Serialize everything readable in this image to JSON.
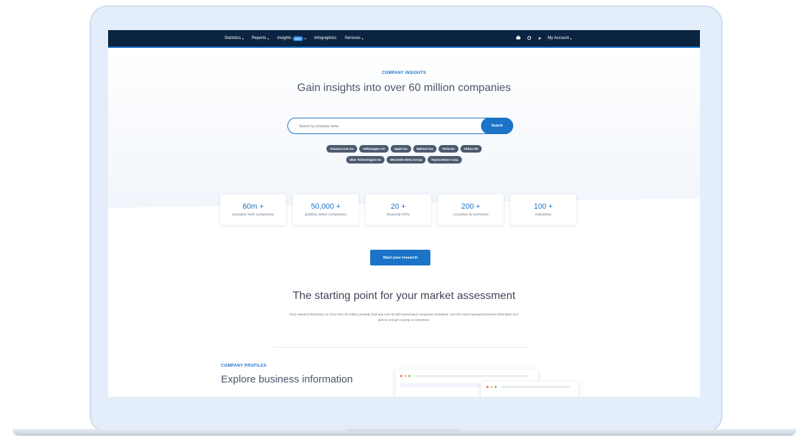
{
  "nav": {
    "items": [
      {
        "label": "Statistics",
        "caret": "▾"
      },
      {
        "label": "Reports",
        "caret": "▾"
      },
      {
        "label": "Insights",
        "badge": "NEW",
        "caret": "▾"
      },
      {
        "label": "Infographics"
      },
      {
        "label": "Services",
        "caret": "▾"
      }
    ],
    "account_label": "My Account",
    "account_caret": "▾",
    "icons": [
      "briefcase-icon",
      "refresh-icon",
      "star-icon"
    ]
  },
  "hero": {
    "eyebrow": "COMPANY INSIGHTS",
    "title": "Gain insights into over 60 million companies",
    "search_placeholder": "Search by company name",
    "search_button": "Search",
    "chips_row1": [
      "Amazon.com Inc",
      "Volkswagen AG",
      "Apple Inc",
      "Walmart Inc",
      "Tesla Inc",
      "Airbus SE"
    ],
    "chips_row2": [
      "Uber Technologies Inc",
      "Mercedes-Benz Group",
      "Toyota Motor Corp."
    ]
  },
  "stats": [
    {
      "value": "60m +",
      "label": "privately held companies"
    },
    {
      "value": "50,000 +",
      "label": "publicly listed companies"
    },
    {
      "value": "20 +",
      "label": "financial KPIs"
    },
    {
      "value": "200 +",
      "label": "countries & territories"
    },
    {
      "value": "100 +",
      "label": "industries"
    }
  ],
  "cta": {
    "label": "Start your research"
  },
  "assessment": {
    "title": "The starting point for your market assessment",
    "description": "Find relevant information on more than 60 million privately held and over 50,000 stock-listed companies worldwide. See the most important business information at a glance and get a grasp on industries."
  },
  "profiles": {
    "eyebrow": "COMPANY PROFILES",
    "title": "Explore business information"
  },
  "colors": {
    "nav_bg": "#0b2441",
    "accent": "#1a73c6",
    "chip_bg": "#4b5a6e",
    "laptop_frame": "#e4eefb"
  }
}
